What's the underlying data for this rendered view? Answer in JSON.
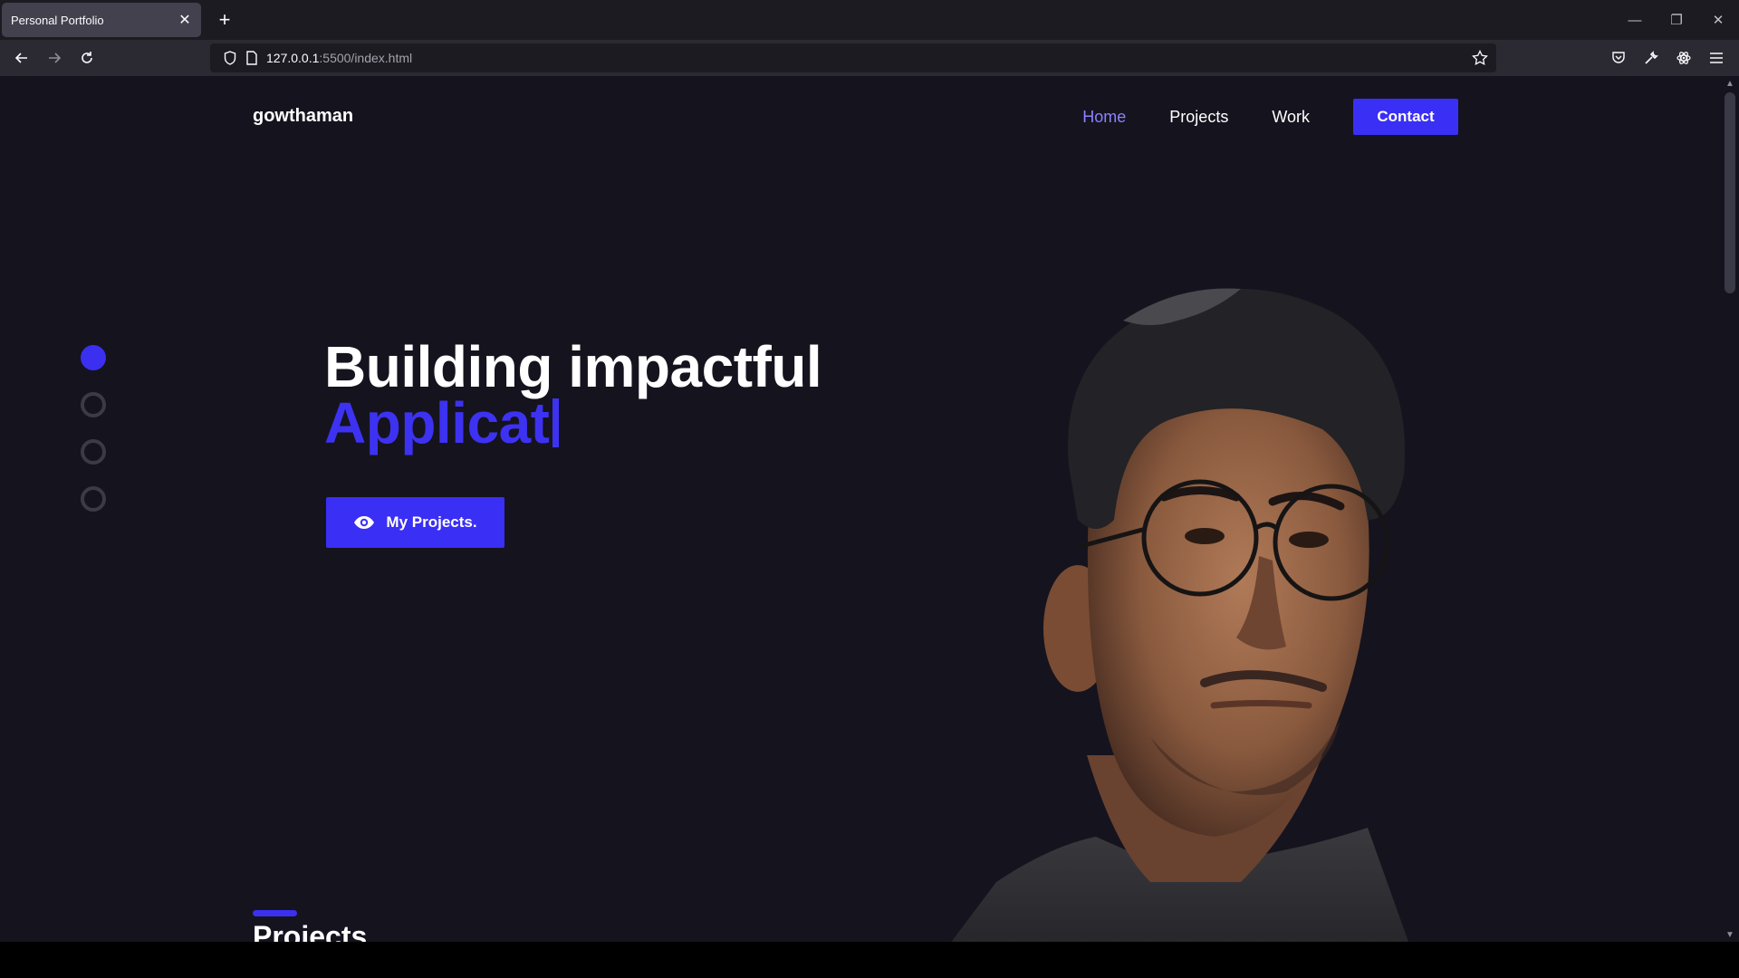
{
  "browser": {
    "tab_title": "Personal Portfolio",
    "url_host": "127.0.0.1",
    "url_rest": ":5500/index.html"
  },
  "site": {
    "brand": "gowthaman",
    "nav": [
      {
        "label": "Home",
        "active": true
      },
      {
        "label": "Projects",
        "active": false
      },
      {
        "label": "Work",
        "active": false
      }
    ],
    "contact_label": "Contact",
    "headline_line1": "Building impactful",
    "headline_line2": "Applicat",
    "cta_label": "My Projects.",
    "section_title": "Projects",
    "slider_dots": 4,
    "active_dot": 0
  },
  "colors": {
    "page_bg": "#15131e",
    "accent": "#3b30f0",
    "nav_active": "#8c82ff"
  },
  "icons": {
    "portrait": "person-portrait-image",
    "cta": "eye-icon"
  }
}
